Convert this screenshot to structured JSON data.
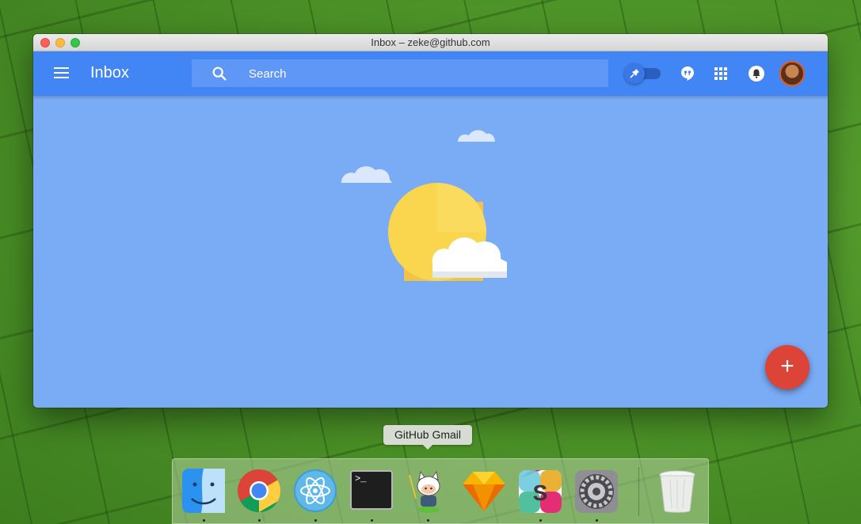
{
  "window": {
    "title": "Inbox – zeke@github.com"
  },
  "appbar": {
    "title": "Inbox",
    "search_placeholder": "Search"
  },
  "fab": {
    "label": "+"
  },
  "dock": {
    "tooltip": "GitHub Gmail",
    "apps": [
      {
        "name": "Finder",
        "icon": "finder-icon",
        "running": true
      },
      {
        "name": "Google Chrome",
        "icon": "chrome-icon",
        "running": true
      },
      {
        "name": "Atom",
        "icon": "atom-icon",
        "running": true
      },
      {
        "name": "Terminal",
        "icon": "terminal-icon",
        "running": true
      },
      {
        "name": "GitHub Gmail",
        "icon": "octocat-icon",
        "running": true
      },
      {
        "name": "Sketch",
        "icon": "sketch-icon",
        "running": false
      },
      {
        "name": "Slack",
        "icon": "slack-icon",
        "running": true
      },
      {
        "name": "System Preferences",
        "icon": "system-preferences-icon",
        "running": true
      },
      {
        "name": "Trash",
        "icon": "trash-icon",
        "running": false
      }
    ],
    "terminal_prompt": ">_"
  },
  "colors": {
    "appbar": "#4285f4",
    "content_bg": "#7aabf5",
    "fab": "#db4437",
    "sun": "#f6c244"
  }
}
